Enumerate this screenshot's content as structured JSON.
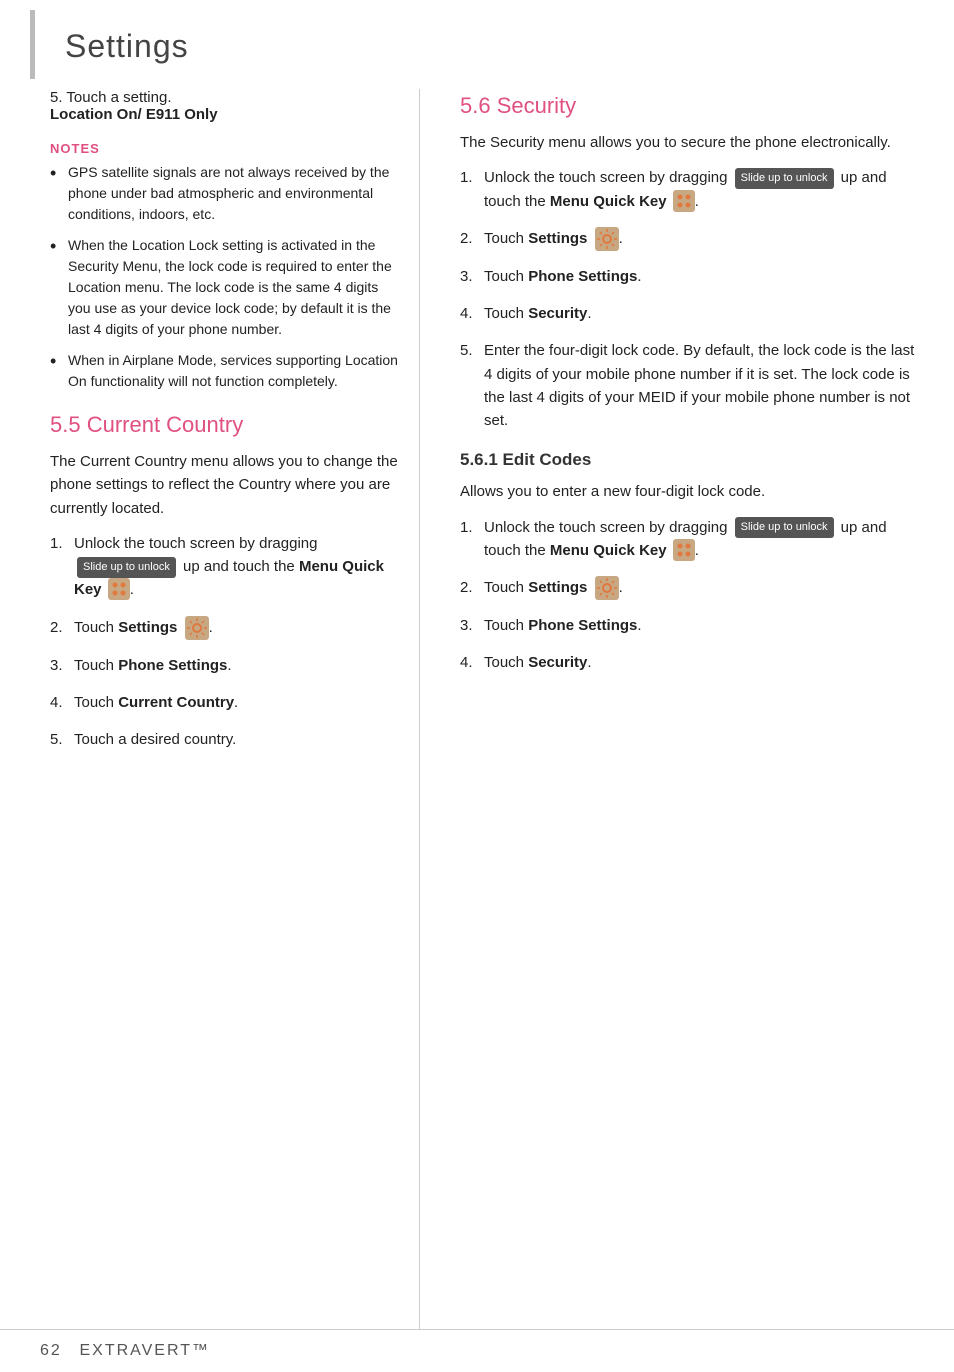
{
  "page": {
    "title": "Settings",
    "footer": {
      "page_num": "62",
      "brand": "Extravert™"
    }
  },
  "left_col": {
    "intro_num": "5.",
    "intro_text": "Touch a setting.",
    "intro_bold": "Location On/ E911 Only",
    "notes_heading": "NOTES",
    "notes": [
      "GPS satellite signals are not always received by the phone under bad atmospheric and environmental conditions, indoors, etc.",
      "When the Location Lock setting is activated in the Security Menu, the lock code is required to enter the Location menu. The lock code is the same 4 digits you use as your device lock code; by default it is the last 4 digits of your phone number.",
      "When in Airplane Mode, services supporting Location On functionality will not function completely."
    ],
    "section_55": {
      "heading": "5.5 Current Country",
      "body": "The Current Country menu allows you to change the phone settings to reflect the Country where you are currently located.",
      "steps": [
        {
          "num": "1.",
          "parts": [
            "Unlock the touch screen by dragging ",
            "Slide up to unlock",
            " up and touch the ",
            "Menu Quick Key",
            " ."
          ]
        },
        {
          "num": "2.",
          "parts": [
            "Touch ",
            "Settings",
            " ."
          ]
        },
        {
          "num": "3.",
          "parts": [
            "Touch ",
            "Phone Settings",
            "."
          ]
        },
        {
          "num": "4.",
          "parts": [
            "Touch ",
            "Current Country",
            "."
          ]
        },
        {
          "num": "5.",
          "parts": [
            "Touch a desired country."
          ]
        }
      ]
    }
  },
  "right_col": {
    "section_56": {
      "heading": "5.6 Security",
      "body": "The Security menu allows you to secure the phone electronically.",
      "steps": [
        {
          "num": "1.",
          "parts": [
            "Unlock the touch screen by dragging ",
            "Slide up to unlock",
            " up and touch the ",
            "Menu Quick Key",
            " ."
          ]
        },
        {
          "num": "2.",
          "parts": [
            "Touch ",
            "Settings",
            " ."
          ]
        },
        {
          "num": "3.",
          "parts": [
            "Touch ",
            "Phone Settings",
            "."
          ]
        },
        {
          "num": "4.",
          "parts": [
            "Touch ",
            "Security",
            "."
          ]
        },
        {
          "num": "5.",
          "parts": [
            "Enter the four-digit lock code. By default, the lock code is the last 4 digits of your mobile phone number if it is set. The lock code is the last 4 digits of your MEID if your mobile phone number is not set."
          ]
        }
      ]
    },
    "section_561": {
      "heading": "5.6.1 Edit Codes",
      "body": "Allows you to enter a new four-digit lock code.",
      "steps": [
        {
          "num": "1.",
          "parts": [
            "Unlock the touch screen by dragging ",
            "Slide up to unlock",
            " up and touch the ",
            "Menu Quick Key",
            " ."
          ]
        },
        {
          "num": "2.",
          "parts": [
            "Touch ",
            "Settings",
            " ."
          ]
        },
        {
          "num": "3.",
          "parts": [
            "Touch ",
            "Phone Settings",
            "."
          ]
        },
        {
          "num": "4.",
          "parts": [
            "Touch ",
            "Security",
            "."
          ]
        }
      ]
    }
  }
}
